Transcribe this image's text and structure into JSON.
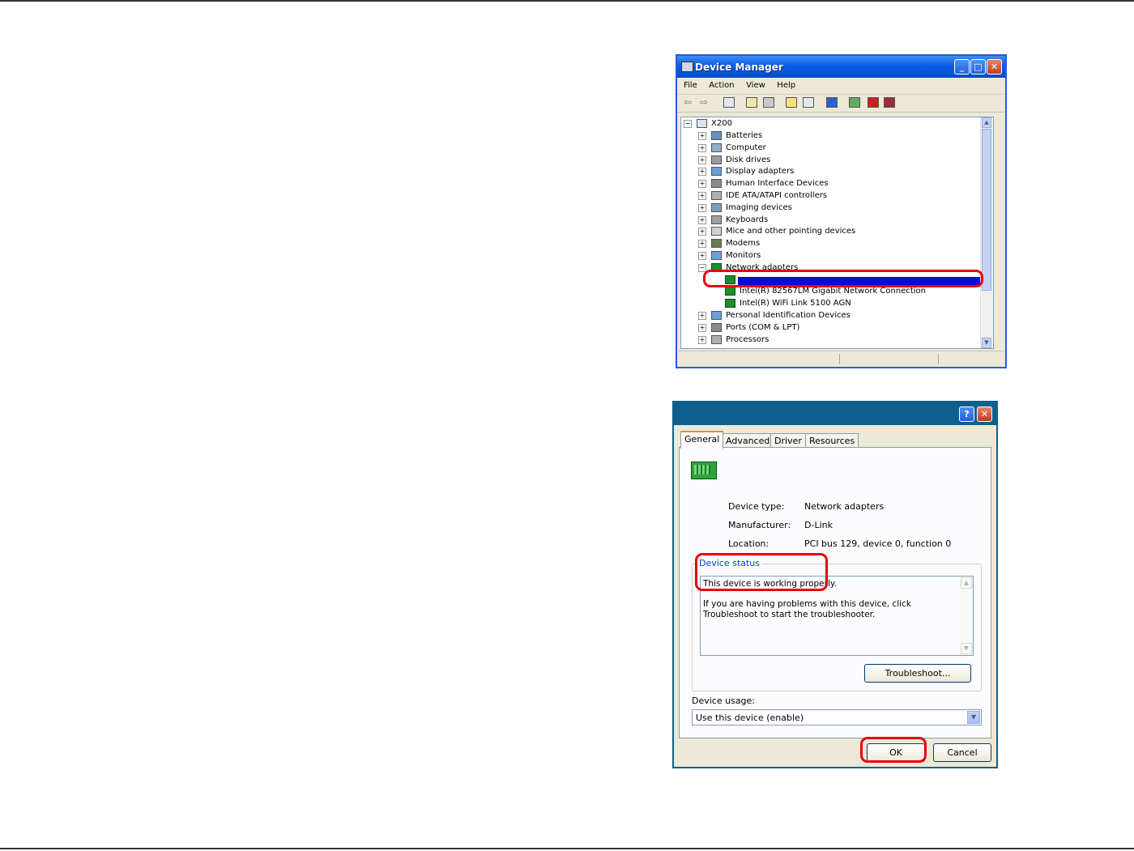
{
  "device_manager": {
    "title": "Device Manager",
    "title_buttons": {
      "minimize": "_",
      "maximize": "□",
      "close": "✕"
    },
    "menu": [
      "File",
      "Action",
      "View",
      "Help"
    ],
    "toolbar_icons": [
      "back-icon",
      "forward-icon",
      "console-icon",
      "properties-icon",
      "print-icon",
      "help-icon",
      "view-icon",
      "scan-hardware-icon",
      "update-driver-icon",
      "uninstall-icon",
      "disable-icon"
    ],
    "tree": {
      "root": "X200",
      "categories": [
        "Batteries",
        "Computer",
        "Disk drives",
        "Display adapters",
        "Human Interface Devices",
        "IDE ATA/ATAPI controllers",
        "Imaging devices",
        "Keyboards",
        "Mice and other pointing devices",
        "Modems",
        "Monitors",
        "Network adapters"
      ],
      "network_children": [
        "",
        "Intel(R) 82567LM Gigabit Network Connection",
        "Intel(R) WiFi Link 5100 AGN"
      ],
      "categories_after": [
        "Personal Identification Devices",
        "Ports (COM & LPT)",
        "Processors"
      ]
    }
  },
  "properties_dialog": {
    "title_buttons": {
      "help": "?",
      "close": "✕"
    },
    "tabs": [
      "General",
      "Advanced",
      "Driver",
      "Resources"
    ],
    "active_tab": "General",
    "device_type_label": "Device type:",
    "device_type_value": "Network adapters",
    "manufacturer_label": "Manufacturer:",
    "manufacturer_value": "D-Link",
    "location_label": "Location:",
    "location_value": "PCI bus 129, device 0, function 0",
    "status_legend": "Device status",
    "status_line1": "This device is working properly.",
    "status_line2": "If you are having problems with this device, click Troubleshoot to start the troubleshooter.",
    "troubleshoot_label": "Troubleshoot...",
    "usage_label": "Device usage:",
    "usage_value": "Use this device (enable)",
    "ok_label": "OK",
    "cancel_label": "Cancel"
  }
}
